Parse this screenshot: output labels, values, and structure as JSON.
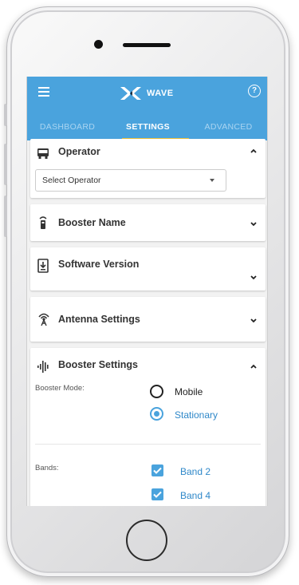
{
  "app": {
    "logo_text": "WAVE",
    "brand_color": "#4aa3dd",
    "tab_indicator_color": "#f0c23a"
  },
  "tabs": [
    {
      "label": "DASHBOARD",
      "active": false
    },
    {
      "label": "SETTINGS",
      "active": true
    },
    {
      "label": "ADVANCED",
      "active": false
    }
  ],
  "operator": {
    "title": "Operator",
    "icon": "bus-icon",
    "expanded": true,
    "select_value": "Select Operator"
  },
  "booster_name": {
    "title": "Booster Name",
    "icon": "booster-device-icon",
    "expanded": false
  },
  "software_version": {
    "title": "Software Version",
    "icon": "download-icon",
    "expanded": false
  },
  "antenna_settings": {
    "title": "Antenna Settings",
    "icon": "antenna-icon",
    "expanded": false
  },
  "booster_settings": {
    "title": "Booster Settings",
    "icon": "signal-bars-icon",
    "expanded": true,
    "mode_label": "Booster Mode:",
    "modes": [
      {
        "label": "Mobile",
        "selected": false
      },
      {
        "label": "Stationary",
        "selected": true
      }
    ],
    "bands_label": "Bands:",
    "bands": [
      {
        "label": "Band 2",
        "checked": true
      },
      {
        "label": "Band 4",
        "checked": true
      }
    ]
  }
}
